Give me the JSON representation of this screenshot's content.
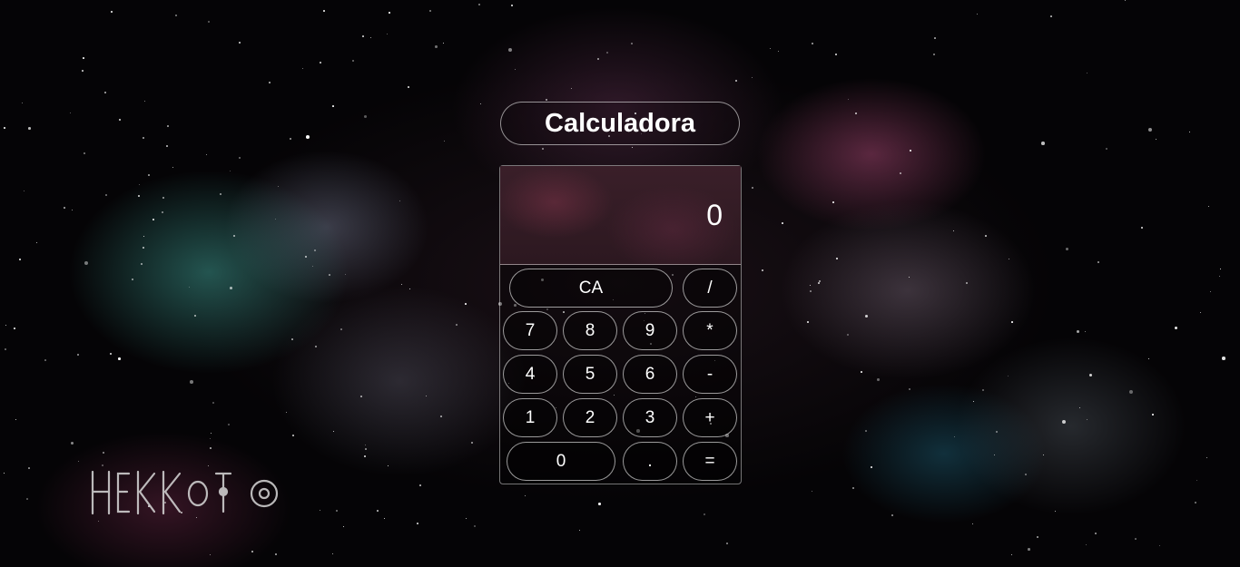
{
  "app": {
    "title": "Calculadora",
    "display_value": "0",
    "logo_text": "HEKKOTO"
  },
  "keys": {
    "clear": "CA",
    "divide": "/",
    "seven": "7",
    "eight": "8",
    "nine": "9",
    "multiply": "*",
    "four": "4",
    "five": "5",
    "six": "6",
    "subtract": "-",
    "one": "1",
    "two": "2",
    "three": "3",
    "add": "+",
    "zero": "0",
    "decimal": ".",
    "equals": "="
  },
  "colors": {
    "text": "#ffffff",
    "border": "#ffffffaa",
    "display_bg": "#3a1f29",
    "space_bg": "#050406"
  }
}
